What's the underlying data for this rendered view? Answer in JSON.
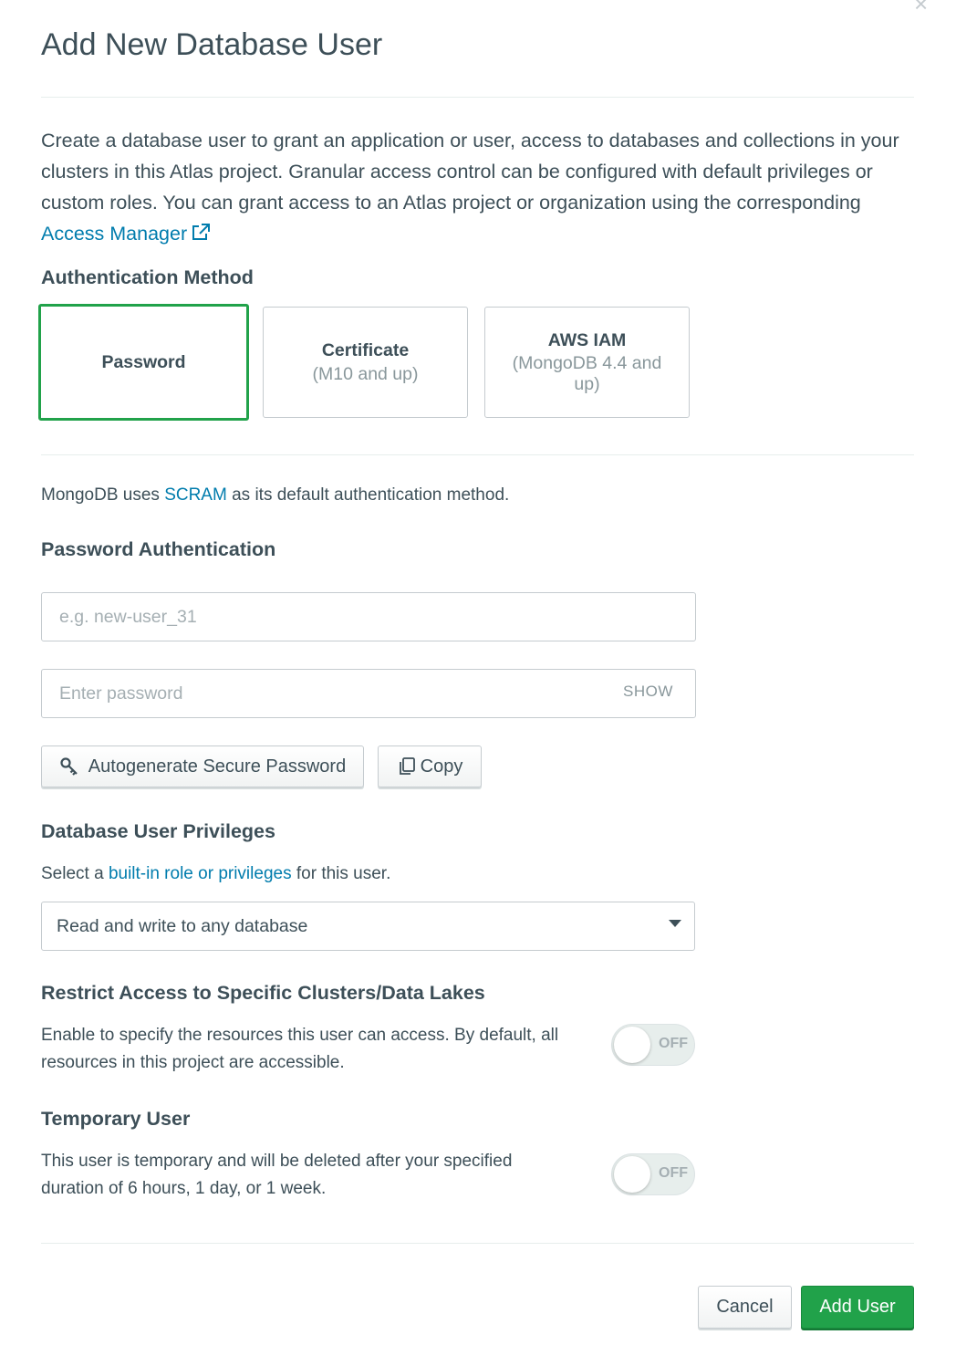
{
  "modal": {
    "title": "Add New Database User",
    "close_glyph": "×",
    "intro_text": "Create a database user to grant an application or user, access to databases and collections in your clusters in this Atlas project. Granular access control can be configured with default privileges or custom roles. You can grant access to an Atlas project or organization using the corresponding",
    "intro_link": "Access Manager"
  },
  "auth": {
    "heading": "Authentication Method",
    "methods": [
      {
        "title": "Password",
        "subtitle": "",
        "selected": true
      },
      {
        "title": "Certificate",
        "subtitle": "(M10 and up)",
        "selected": false
      },
      {
        "title": "AWS IAM",
        "subtitle": "(MongoDB 4.4 and up)",
        "selected": false
      }
    ],
    "note_prefix": "MongoDB uses",
    "note_link": "SCRAM",
    "note_suffix": "as its default authentication method."
  },
  "password_auth": {
    "heading": "Password Authentication",
    "username_placeholder": "e.g. new-user_31",
    "username_value": "",
    "password_placeholder": "Enter password",
    "password_value": "",
    "show_label": "SHOW",
    "autogenerate_label": "Autogenerate Secure Password",
    "copy_label": "Copy"
  },
  "privileges": {
    "heading": "Database User Privileges",
    "desc_prefix": "Select a",
    "desc_link": "built-in role or privileges",
    "desc_suffix": "for this user.",
    "selected_role": "Read and write to any database"
  },
  "restrict": {
    "heading": "Restrict Access to Specific Clusters/Data Lakes",
    "description": "Enable to specify the resources this user can access. By default, all resources in this project are accessible.",
    "toggle_label": "OFF",
    "enabled": false
  },
  "temporary": {
    "heading": "Temporary User",
    "description": "This user is temporary and will be deleted after your specified duration of 6 hours, 1 day, or 1 week.",
    "toggle_label": "OFF",
    "enabled": false
  },
  "footer": {
    "cancel_label": "Cancel",
    "submit_label": "Add User"
  },
  "colors": {
    "primary_green": "#21a24a",
    "link_blue": "#007cad",
    "text": "#3d4f58",
    "muted": "#89979b"
  }
}
